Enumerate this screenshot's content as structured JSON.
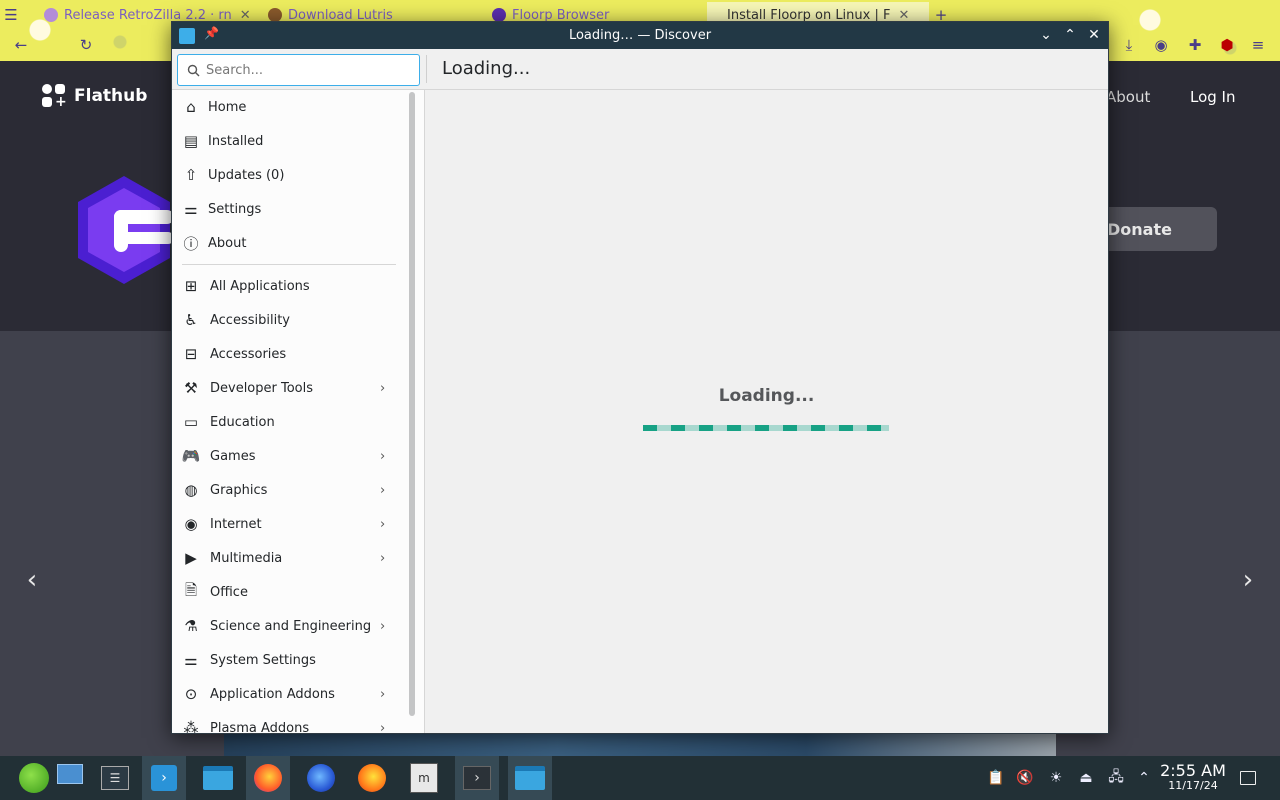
{
  "browser": {
    "tabs": [
      {
        "title": "Release RetroZilla 2.2 · rn"
      },
      {
        "title": "Download Lutris"
      },
      {
        "title": "Floorp Browser"
      },
      {
        "title": "Install Floorp on Linux | F"
      }
    ],
    "new_tab_glyph": "+"
  },
  "flathub": {
    "logo_text": "Flathub",
    "nav_about": "About",
    "nav_login": "Log In",
    "donate_label": "Donate"
  },
  "window": {
    "title": "Loading… — Discover",
    "search_placeholder": "Search...",
    "page_heading": "Loading...",
    "loading_label": "Loading..."
  },
  "sidebar": {
    "top_items": [
      {
        "label": "Home",
        "icon": "home-icon"
      },
      {
        "label": "Installed",
        "icon": "installed-icon"
      },
      {
        "label": "Updates (0)",
        "icon": "updates-icon"
      },
      {
        "label": "Settings",
        "icon": "settings-icon"
      },
      {
        "label": "About",
        "icon": "info-icon"
      }
    ],
    "categories": [
      {
        "label": "All Applications",
        "icon": "grid-icon",
        "has_children": false
      },
      {
        "label": "Accessibility",
        "icon": "accessibility-icon",
        "has_children": false
      },
      {
        "label": "Accessories",
        "icon": "toolbox-icon",
        "has_children": false
      },
      {
        "label": "Developer Tools",
        "icon": "hammer-icon",
        "has_children": true
      },
      {
        "label": "Education",
        "icon": "education-icon",
        "has_children": false
      },
      {
        "label": "Games",
        "icon": "gamepad-icon",
        "has_children": true
      },
      {
        "label": "Graphics",
        "icon": "graphics-icon",
        "has_children": true
      },
      {
        "label": "Internet",
        "icon": "globe-icon",
        "has_children": true
      },
      {
        "label": "Multimedia",
        "icon": "multimedia-icon",
        "has_children": true
      },
      {
        "label": "Office",
        "icon": "office-icon",
        "has_children": false
      },
      {
        "label": "Science and Engineering",
        "icon": "flask-icon",
        "has_children": true
      },
      {
        "label": "System Settings",
        "icon": "sliders-icon",
        "has_children": false
      },
      {
        "label": "Application Addons",
        "icon": "addons-icon",
        "has_children": true
      },
      {
        "label": "Plasma Addons",
        "icon": "plasma-addons-icon",
        "has_children": true
      }
    ]
  },
  "taskbar": {
    "clock_time": "2:55 AM",
    "clock_date": "11/17/24"
  },
  "colors": {
    "accent": "#3daee9",
    "progress": "#17a285",
    "titlebar": "#223845",
    "taskbar": "#223036"
  }
}
